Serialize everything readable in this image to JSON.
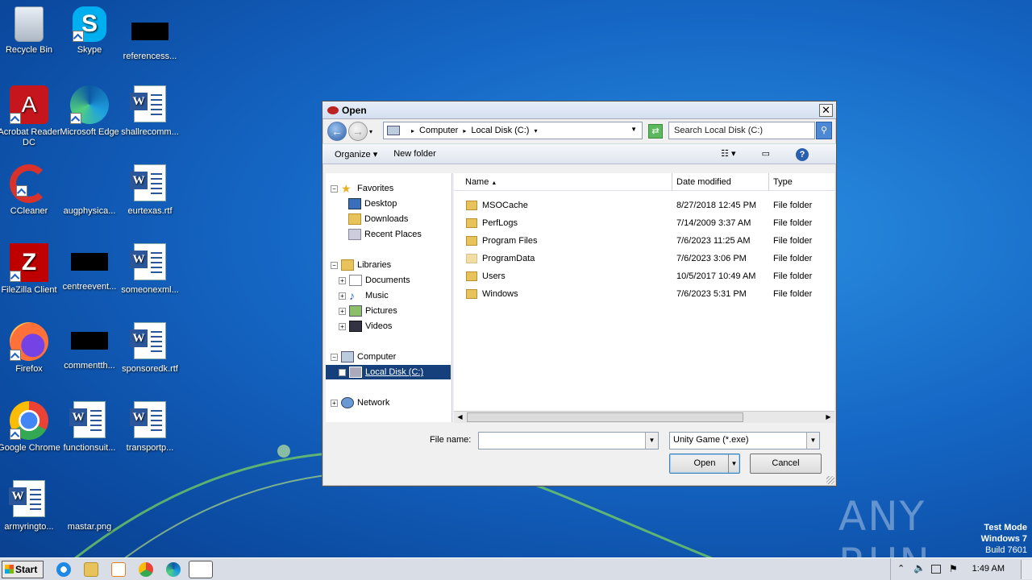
{
  "desktop": {
    "icons": [
      {
        "label": "Recycle Bin"
      },
      {
        "label": "Skype"
      },
      {
        "label": "referencess..."
      },
      {
        "label": "Acrobat Reader DC"
      },
      {
        "label": "Microsoft Edge"
      },
      {
        "label": "shallrecomm..."
      },
      {
        "label": "CCleaner"
      },
      {
        "label": "augphysica..."
      },
      {
        "label": "eurtexas.rtf"
      },
      {
        "label": "FileZilla Client"
      },
      {
        "label": "centreevent..."
      },
      {
        "label": "someonexml..."
      },
      {
        "label": "Firefox"
      },
      {
        "label": "commentth..."
      },
      {
        "label": "sponsoredk.rtf"
      },
      {
        "label": "Google Chrome"
      },
      {
        "label": "functionsuit..."
      },
      {
        "label": "transportp..."
      },
      {
        "label": "armyringto..."
      },
      {
        "label": "mastar.png"
      }
    ],
    "watermark": "ANY RUN",
    "test_mode": {
      "line1": "Test Mode",
      "line2": "Windows 7",
      "line3": "Build 7601"
    }
  },
  "dialog": {
    "title": "Open",
    "close_label": "✕",
    "address": {
      "segments": [
        "Computer",
        "Local Disk (C:)"
      ]
    },
    "search_placeholder": "Search Local Disk (C:)",
    "toolbar": {
      "organize": "Organize ▾",
      "new_folder": "New folder",
      "help": "?"
    },
    "nav": {
      "favorites": "Favorites",
      "desktop": "Desktop",
      "downloads": "Downloads",
      "recent": "Recent Places",
      "libraries": "Libraries",
      "documents": "Documents",
      "music": "Music",
      "pictures": "Pictures",
      "videos": "Videos",
      "computer": "Computer",
      "local_disk": "Local Disk (C:)",
      "network": "Network"
    },
    "columns": {
      "name": "Name",
      "date": "Date modified",
      "type": "Type"
    },
    "files": [
      {
        "name": "MSOCache",
        "date": "8/27/2018 12:45 PM",
        "type": "File folder"
      },
      {
        "name": "PerfLogs",
        "date": "7/14/2009 3:37 AM",
        "type": "File folder"
      },
      {
        "name": "Program Files",
        "date": "7/6/2023 11:25 AM",
        "type": "File folder"
      },
      {
        "name": "ProgramData",
        "date": "7/6/2023 3:06 PM",
        "type": "File folder"
      },
      {
        "name": "Users",
        "date": "10/5/2017 10:49 AM",
        "type": "File folder"
      },
      {
        "name": "Windows",
        "date": "7/6/2023 5:31 PM",
        "type": "File folder"
      }
    ],
    "file_name_label": "File name:",
    "file_name_value": "",
    "file_type": "Unity Game (*.exe)",
    "open_label": "Open",
    "cancel_label": "Cancel"
  },
  "taskbar": {
    "start_label": "Start",
    "clock": "1:49 AM"
  }
}
